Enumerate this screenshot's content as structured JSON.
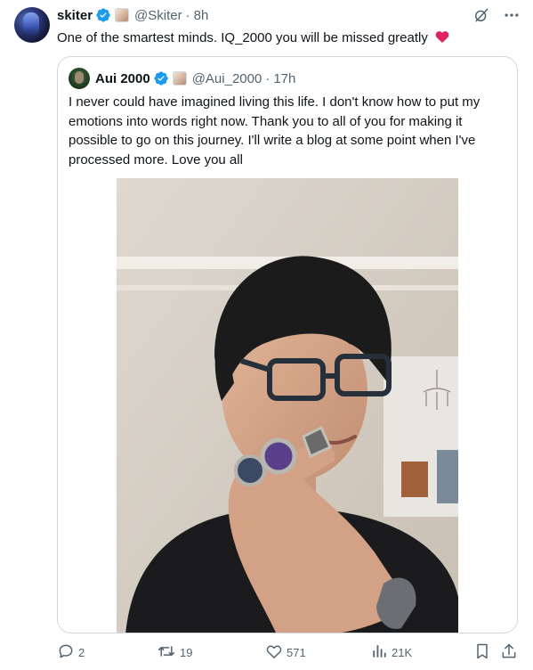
{
  "tweet": {
    "author": {
      "name": "skiter",
      "handle": "@Skiter",
      "time": "8h"
    },
    "text": "One of the smartest minds. IQ_2000 you will be missed greatly",
    "quoted": {
      "author": {
        "name": "Aui 2000",
        "handle": "@Aui_2000",
        "time": "17h"
      },
      "text": "I never could have imagined living this life. I don't know how to put my emotions into words right now. Thank you to all of you for making it possible to go on this journey. I'll write a blog at some point when I've processed more. Love you all"
    },
    "stats": {
      "replies": "2",
      "reposts": "19",
      "likes": "571",
      "views": "21K"
    }
  },
  "dot_separator": "·",
  "icons": {
    "verified": "verified-badge-icon",
    "affiliate": "affiliate-badge-icon",
    "grok": "grok-icon",
    "more": "more-icon",
    "heart": "red-heart-emoji-icon",
    "reply": "reply-icon",
    "repost": "repost-icon",
    "like": "like-icon",
    "views": "views-icon",
    "bookmark": "bookmark-icon",
    "share": "share-icon"
  },
  "colors": {
    "verified": "#1d9bf0",
    "secondary_text": "#536471",
    "border": "#cfd9de",
    "heart": "#e0245e"
  }
}
